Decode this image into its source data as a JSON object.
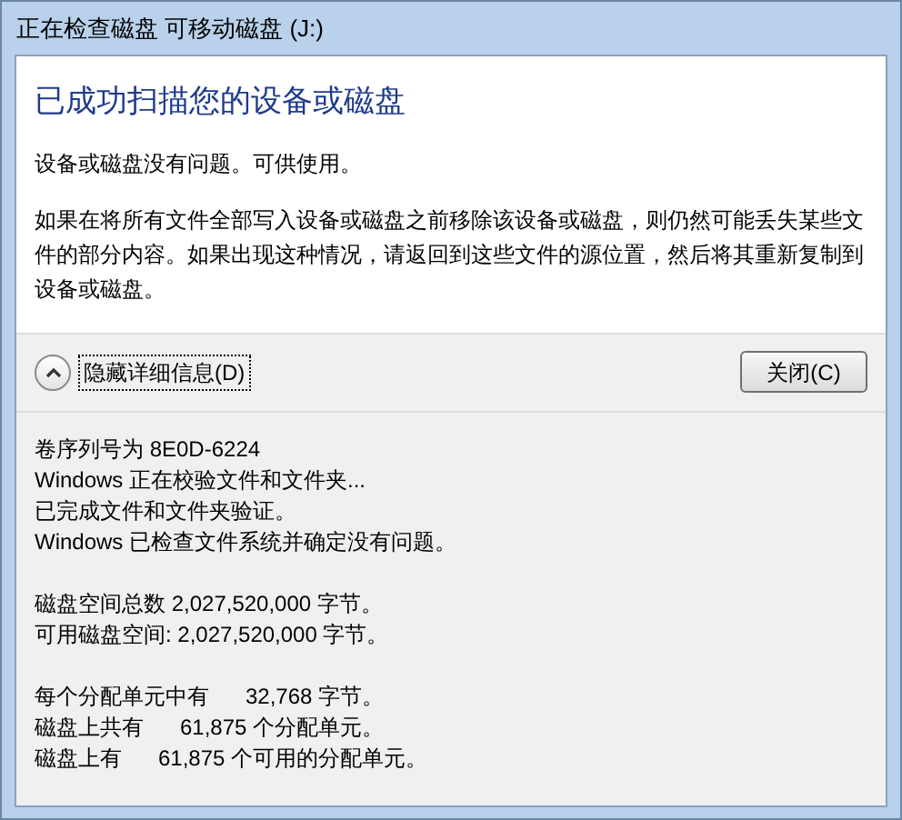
{
  "window": {
    "title": "正在检查磁盘 可移动磁盘 (J:)"
  },
  "heading": "已成功扫描您的设备或磁盘",
  "paragraphs": [
    "设备或磁盘没有问题。可供使用。",
    "如果在将所有文件全部写入设备或磁盘之前移除该设备或磁盘，则仍然可能丢失某些文件的部分内容。如果出现这种情况，请返回到这些文件的源位置，然后将其重新复制到设备或磁盘。"
  ],
  "details_toggle": {
    "label": "隐藏详细信息(D)",
    "expanded": true
  },
  "close_button": "关闭(C)",
  "details": [
    [
      "卷序列号为 8E0D-6224",
      "Windows 正在校验文件和文件夹...",
      "已完成文件和文件夹验证。",
      "Windows 已检查文件系统并确定没有问题。"
    ],
    [
      "磁盘空间总数 2,027,520,000 字节。",
      "可用磁盘空间: 2,027,520,000 字节。"
    ],
    [
      "每个分配单元中有      32,768 字节。",
      "磁盘上共有      61,875 个分配单元。",
      "磁盘上有      61,875 个可用的分配单元。"
    ]
  ]
}
